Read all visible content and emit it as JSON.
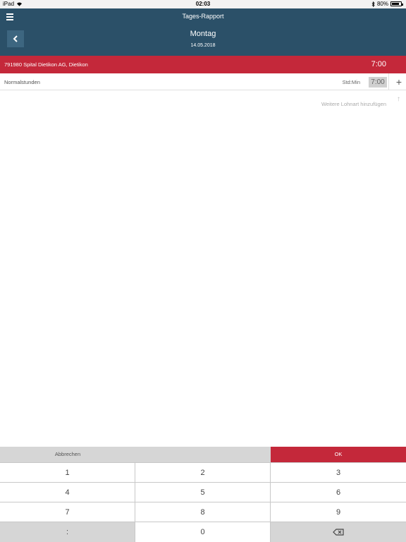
{
  "status": {
    "device": "iPad",
    "time": "02:03",
    "battery": "80%"
  },
  "header": {
    "title": "Tages-Rapport",
    "day": "Montag",
    "date": "14.05.2018"
  },
  "project": {
    "name": "791980 Spital Dietikon AG, Dietikon",
    "total": "7:00"
  },
  "entry": {
    "label": "Normalstunden",
    "unit": "Std:Min",
    "value": "7:00",
    "add": "+"
  },
  "more": {
    "label": "Weitere Lohnart hinzufügen",
    "arrow": "↑"
  },
  "keypad": {
    "cancel": "Abbrechen",
    "ok": "OK",
    "keys": [
      "1",
      "2",
      "3",
      "4",
      "5",
      "6",
      "7",
      "8",
      "9",
      ":",
      "0"
    ]
  }
}
